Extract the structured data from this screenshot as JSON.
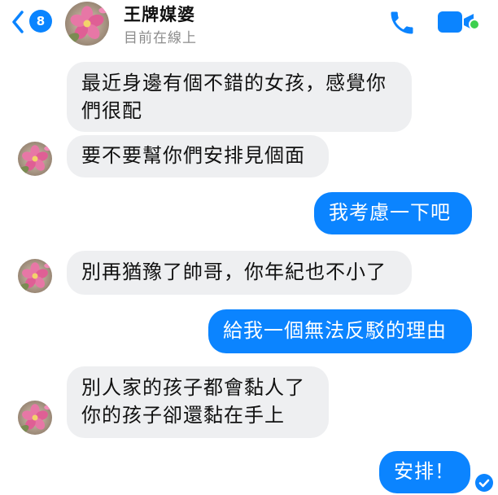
{
  "header": {
    "back_badge_count": "8",
    "contact_name": "王牌媒婆",
    "status": "目前在線上",
    "icons": [
      "chevron-left-icon",
      "phone-icon",
      "video-camera-icon"
    ],
    "accent_color": "#0b84ff",
    "online_color": "#3ccf4e"
  },
  "messages": [
    {
      "sender": "contact",
      "lines": [
        "最近身邊有個不錯的女孩，感覺你",
        "們很配"
      ]
    },
    {
      "sender": "contact",
      "lines": [
        "要不要幫你們安排見個面"
      ]
    },
    {
      "sender": "me",
      "lines": [
        "我考慮一下吧"
      ]
    },
    {
      "sender": "contact",
      "lines": [
        "別再猶豫了帥哥，你年紀也不小了"
      ]
    },
    {
      "sender": "me",
      "lines": [
        "給我一個無法反駁的理由"
      ]
    },
    {
      "sender": "contact",
      "lines": [
        "別人家的孩子都會黏人了",
        "你的孩子卻還黏在手上"
      ]
    },
    {
      "sender": "me",
      "lines": [
        "安排！"
      ]
    }
  ]
}
